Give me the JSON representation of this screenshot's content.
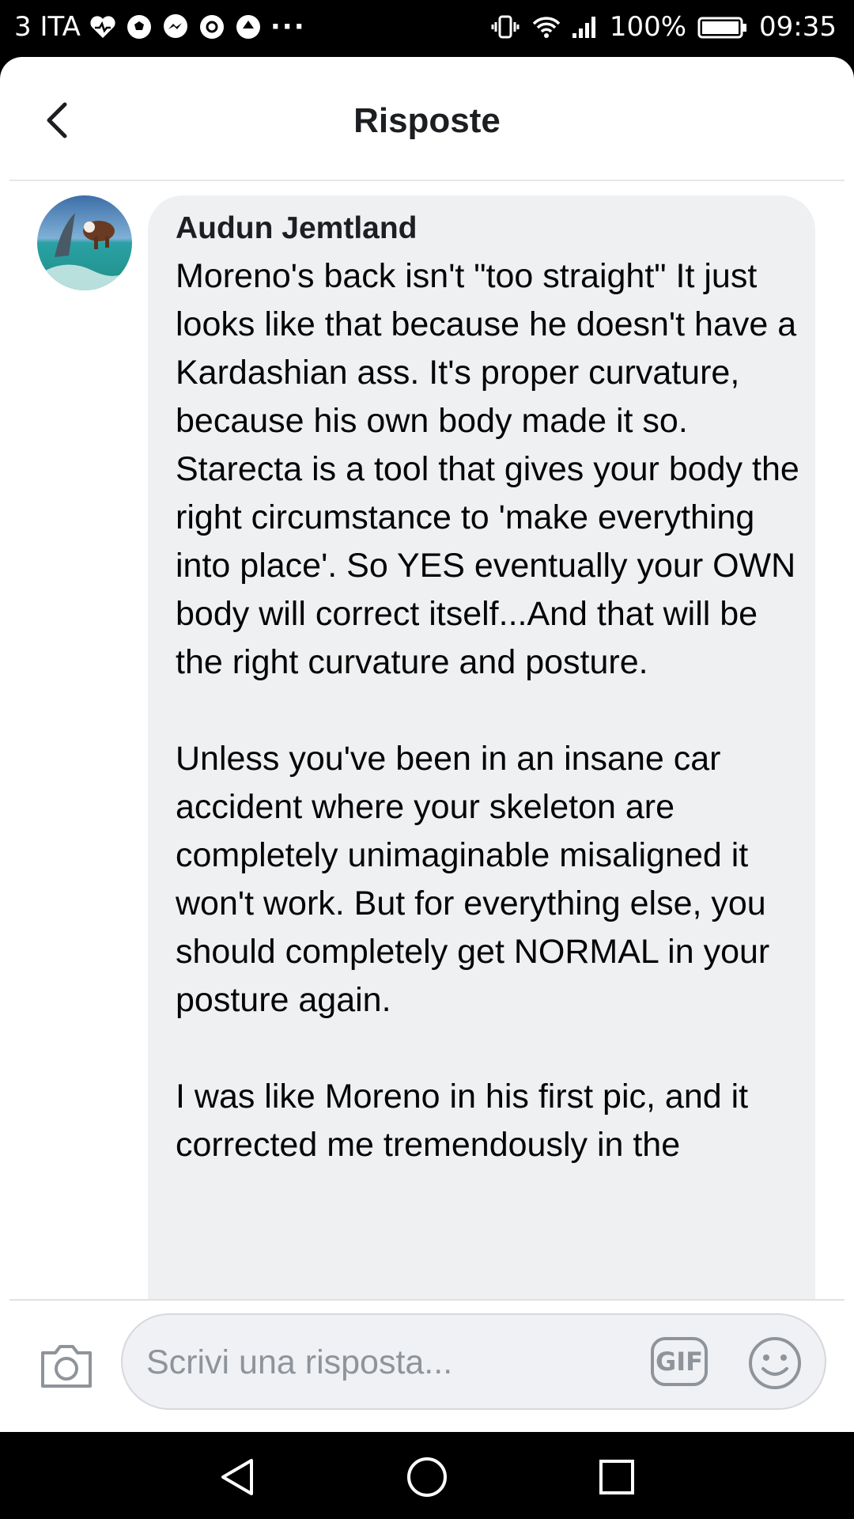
{
  "status_bar": {
    "carrier": "3 ITA",
    "more": "···",
    "battery_percent": "100%",
    "time": "09:35"
  },
  "header": {
    "title": "Risposte"
  },
  "comment": {
    "author": "Audun Jemtland",
    "paragraphs": [
      "Moreno's back isn't \"too straight\" It just looks like that because he doesn't have a Kardashian ass. It's proper curvature, because his own body made it so. Starecta is a tool that gives your body the right circumstance to 'make everything into place'. So YES eventually your OWN body will correct itself...And that will be the right curvature and posture.",
      "Unless you've been in an insane car accident where your skeleton are completely unimaginable misaligned it won't work. But for everything else, you should completely get NORMAL in your posture again.",
      "I was like Moreno in his first pic, and it corrected me tremendously in the"
    ]
  },
  "composer": {
    "placeholder": "Scrivi una risposta...",
    "gif_label": "GIF"
  }
}
